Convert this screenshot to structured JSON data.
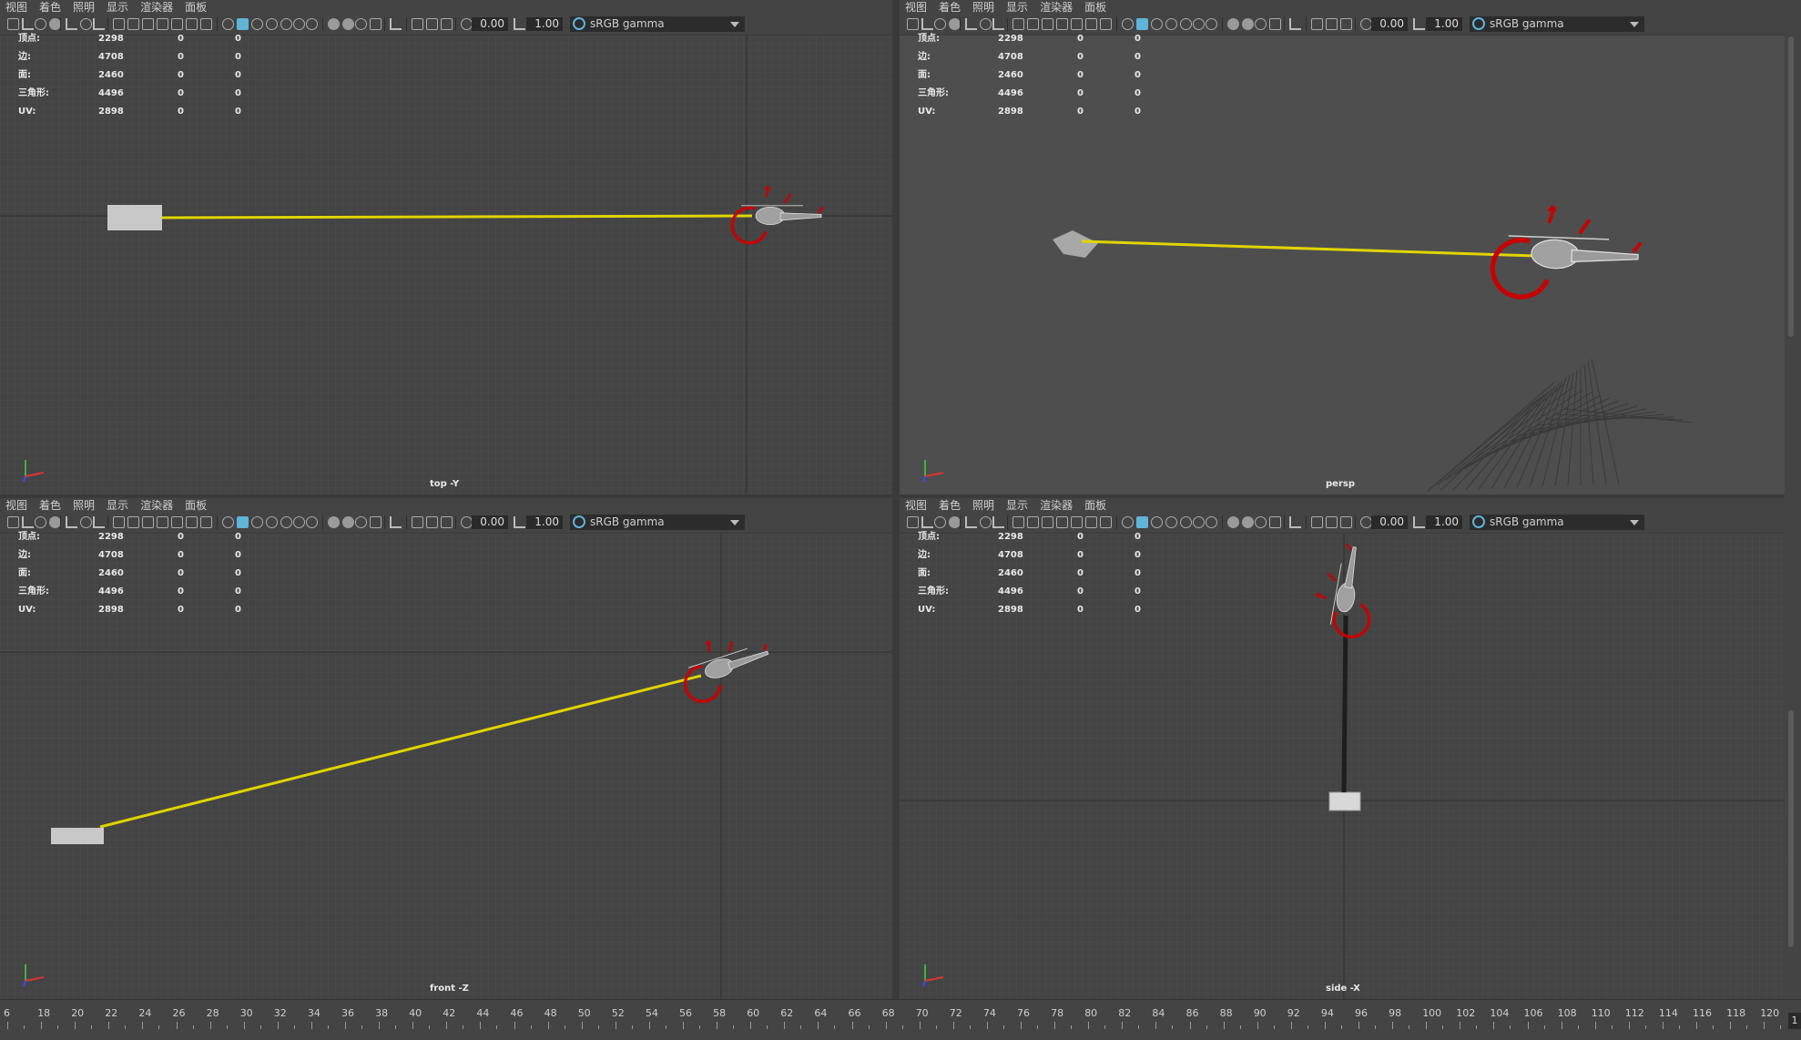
{
  "panels": [
    {
      "id": "top",
      "camera": "top -Y",
      "numA": "0.00",
      "numB": "1.00",
      "colorspace": "sRGB gamma"
    },
    {
      "id": "persp",
      "camera": "persp",
      "numA": "0.00",
      "numB": "1.00",
      "colorspace": "sRGB gamma"
    },
    {
      "id": "front",
      "camera": "front -Z",
      "numA": "0.00",
      "numB": "1.00",
      "colorspace": "sRGB gamma"
    },
    {
      "id": "side",
      "camera": "side -X",
      "numA": "0.00",
      "numB": "1.00",
      "colorspace": "sRGB gamma"
    }
  ],
  "menu": [
    "视图",
    "着色",
    "照明",
    "显示",
    "渲染器",
    "面板"
  ],
  "hud": {
    "rows": [
      {
        "label": "顶点:",
        "a": "2298",
        "b": "0",
        "c": "0"
      },
      {
        "label": "边:",
        "a": "4708",
        "b": "0",
        "c": "0"
      },
      {
        "label": "面:",
        "a": "2460",
        "b": "0",
        "c": "0"
      },
      {
        "label": "三角形:",
        "a": "4496",
        "b": "0",
        "c": "0"
      },
      {
        "label": "UV:",
        "a": "2898",
        "b": "0",
        "c": "0"
      }
    ]
  },
  "timeline": {
    "ticks": [
      "6",
      "18",
      "20",
      "22",
      "24",
      "26",
      "28",
      "30",
      "32",
      "34",
      "36",
      "38",
      "40",
      "42",
      "44",
      "46",
      "48",
      "50",
      "52",
      "54",
      "56",
      "58",
      "60",
      "62",
      "64",
      "66",
      "68",
      "70",
      "72",
      "74",
      "76",
      "78",
      "80",
      "82",
      "84",
      "86",
      "88",
      "90",
      "92",
      "94",
      "96",
      "98",
      "100",
      "102",
      "104",
      "106",
      "108",
      "110",
      "112",
      "114",
      "116",
      "118",
      "120"
    ],
    "end_value": "1"
  },
  "colors": {
    "viewport_bg": "#444444",
    "grid": "#4b4b4b",
    "path": "#e0d400",
    "manipulator": "#c80000",
    "accent": "#5fb4d8"
  },
  "icons": [
    "camera-icon",
    "grid-icon",
    "shading-cube-icon",
    "light-icon",
    "isolate-icon",
    "xray-icon",
    "exposure-icon",
    "gamma-icon",
    "colorspace-icon",
    "dropdown-arrow-icon"
  ]
}
